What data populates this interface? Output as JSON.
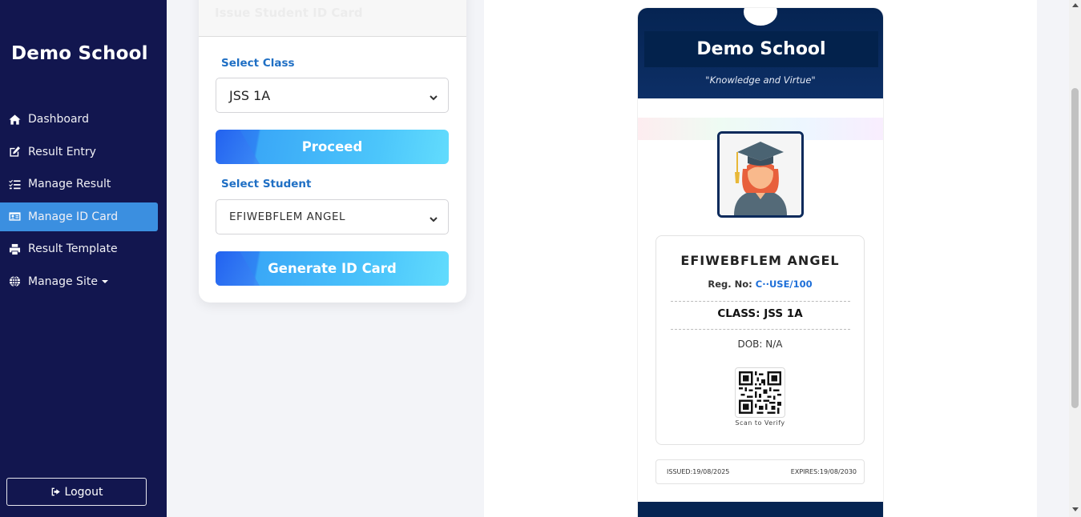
{
  "sidebar": {
    "brand": "Demo School",
    "items": [
      {
        "label": "Dashboard",
        "icon": "home-icon"
      },
      {
        "label": "Result Entry",
        "icon": "edit-icon"
      },
      {
        "label": "Manage Result",
        "icon": "list-check-icon"
      },
      {
        "label": "Manage ID Card",
        "icon": "id-card-icon",
        "active": true
      },
      {
        "label": "Result Template",
        "icon": "print-icon"
      },
      {
        "label": "Manage Site",
        "icon": "globe-icon"
      }
    ],
    "logout_label": "Logout"
  },
  "form": {
    "title": "Issue Student ID Card",
    "class_label": "Select Class",
    "class_value": "JSS 1A",
    "proceed_label": "Proceed",
    "student_label": "Select Student",
    "student_value": "EFIWEBFLEM ANGEL",
    "generate_label": "Generate ID Card"
  },
  "id_card": {
    "school_name": "Demo School",
    "motto": "\"Knowledge and Virtue\"",
    "student_name": "EFIWEBFLEM ANGEL",
    "reg_label": "Reg. No:",
    "reg_value": "C··USE/100",
    "class_text": "CLASS: JSS 1A",
    "dob_text": "DOB: N/A",
    "scan_text": "Scan to Verify",
    "issued_text": "ISSUED:19/08/2025",
    "expires_text": "EXPIRES:19/08/2030"
  },
  "colors": {
    "sidebar_bg": "#12164f",
    "active_item": "#3b8fe0",
    "accent_label": "#1f6fc4",
    "card_header": "#052452"
  }
}
